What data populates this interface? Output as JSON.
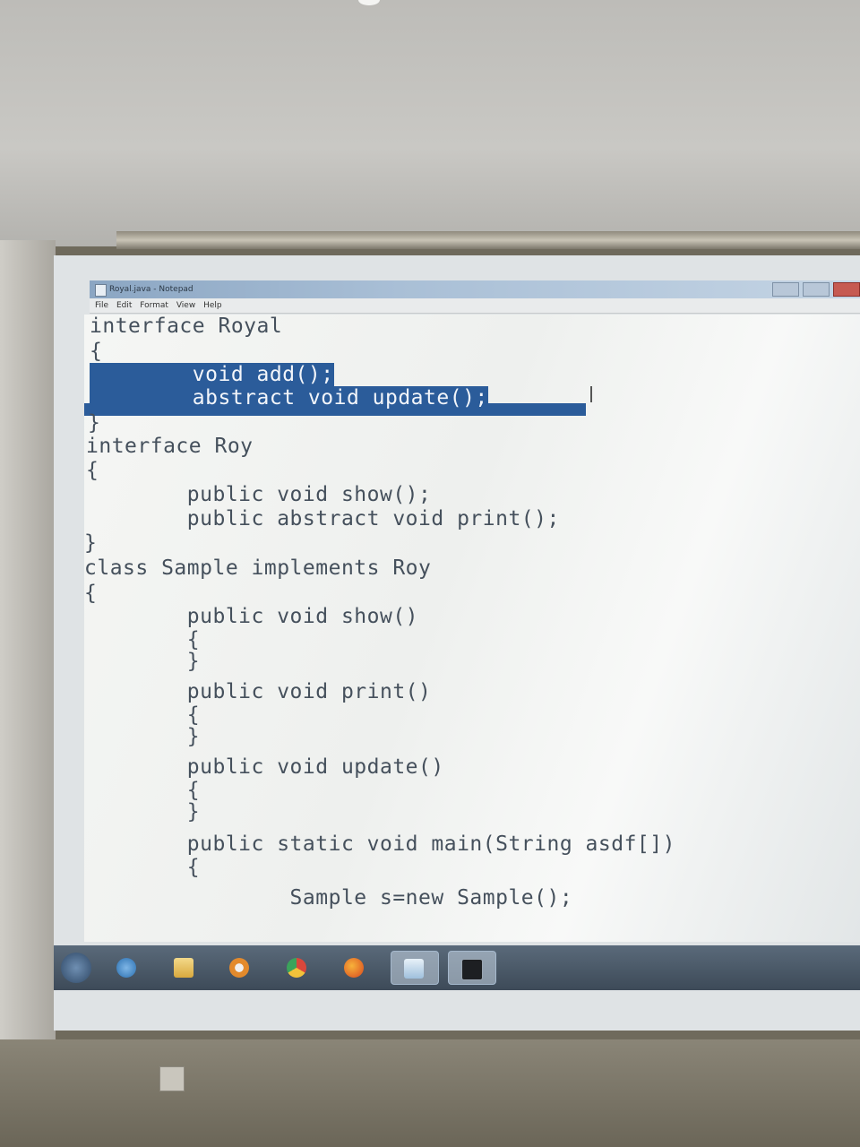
{
  "window": {
    "title": "Royal.java - Notepad"
  },
  "menu": [
    "File",
    "Edit",
    "Format",
    "View",
    "Help"
  ],
  "code_lines": [
    "interface Royal",
    "{",
    "        void add();",
    "        abstract void update();",
    "}",
    "interface Roy",
    "{",
    "        public void show();",
    "        public abstract void print();",
    "}",
    "class Sample implements Roy",
    "{",
    "        public void show()",
    "        {",
    "        }",
    "        public void print()",
    "        {",
    "        }",
    "        public void update()",
    "        {",
    "        }",
    "        public static void main(String asdf[])",
    "        {",
    "                Sample s=new Sample();"
  ],
  "taskbar": {
    "items": [
      "start-button",
      "ie-icon",
      "folder-icon",
      "media-player-icon",
      "chrome-icon",
      "firefox-icon",
      "notepad-icon",
      "cmd-icon"
    ]
  },
  "colors": {
    "selection": "#2b5c9a",
    "code_text": "#45505c"
  }
}
